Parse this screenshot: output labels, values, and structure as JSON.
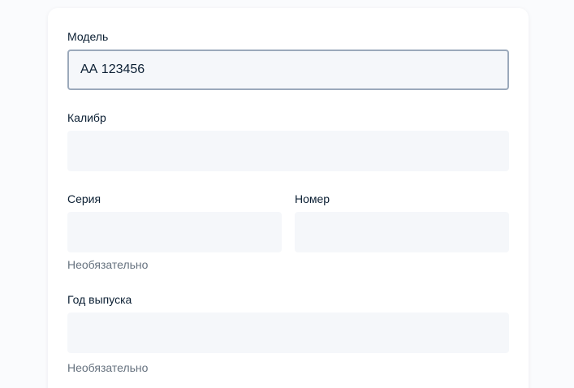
{
  "form": {
    "model": {
      "label": "Модель",
      "value": "АА 123456",
      "placeholder": ""
    },
    "caliber": {
      "label": "Калибр",
      "value": "",
      "placeholder": ""
    },
    "series": {
      "label": "Серия",
      "value": "",
      "placeholder": "",
      "hint": "Необязательно"
    },
    "number": {
      "label": "Номер",
      "value": "",
      "placeholder": ""
    },
    "year": {
      "label": "Год выпуска",
      "value": "",
      "placeholder": "",
      "hint": "Необязательно"
    }
  },
  "colors": {
    "input_background": "#f5f7fa",
    "focus_border": "#9ba9bb",
    "text": "#0b1f33",
    "hint_text": "#66727f"
  }
}
